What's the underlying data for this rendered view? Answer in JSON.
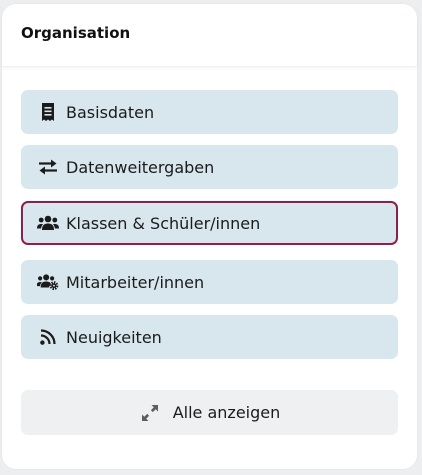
{
  "panel": {
    "title": "Organisation"
  },
  "nav": {
    "items": [
      {
        "label": "Basisdaten",
        "icon": "document-list-icon",
        "active": false
      },
      {
        "label": "Datenweitergaben",
        "icon": "exchange-arrows-icon",
        "active": false
      },
      {
        "label": "Klassen & Schüler/innen",
        "icon": "users-group-icon",
        "active": true
      },
      {
        "label": "Mitarbeiter/innen",
        "icon": "users-gear-icon",
        "active": false
      },
      {
        "label": "Neuigkeiten",
        "icon": "rss-feed-icon",
        "active": false
      }
    ]
  },
  "footer": {
    "show_all_label": "Alle anzeigen",
    "show_all_icon": "expand-arrows-icon"
  },
  "colors": {
    "item_background": "#d8e6ee",
    "active_border": "#8e1f45",
    "show_all_background": "#eef0f1"
  }
}
